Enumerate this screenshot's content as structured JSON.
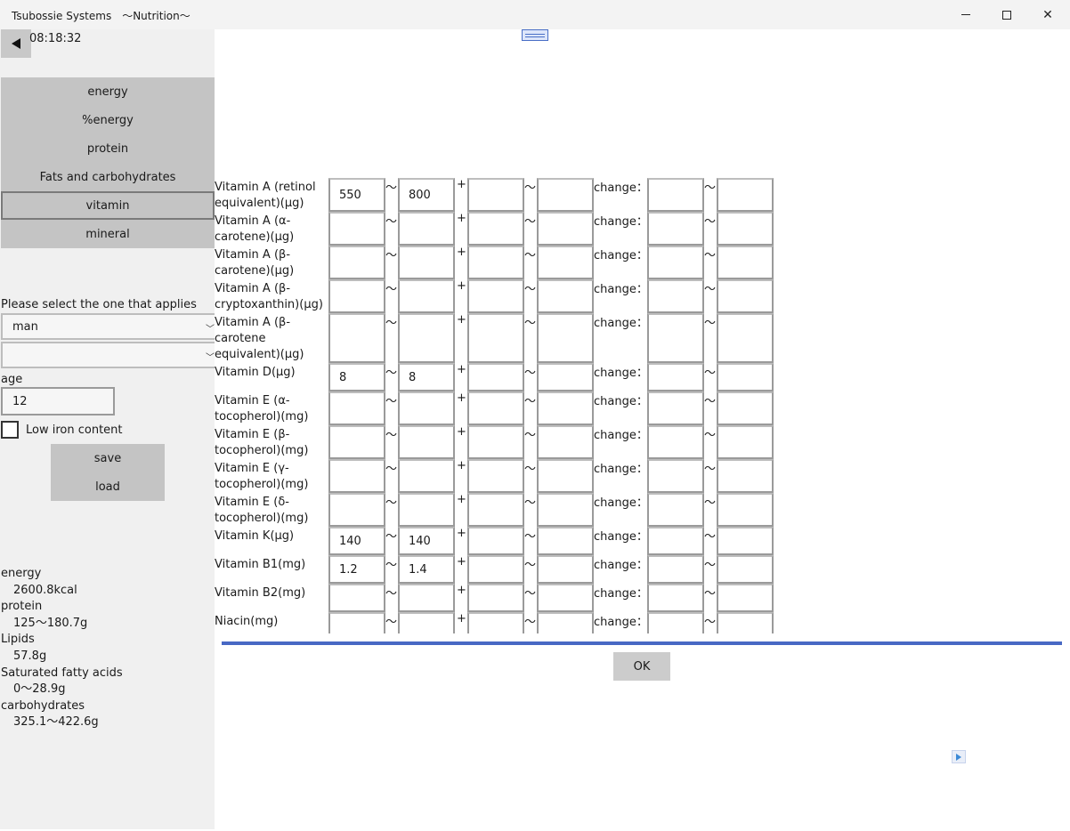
{
  "window": {
    "title": "Tsubossie Systems　〜Nutrition〜",
    "minimize_icon": "minimize-icon",
    "maximize_icon": "maximize-icon",
    "close_glyph": "✕"
  },
  "sidebar": {
    "clock": "08:18:32",
    "nav": [
      {
        "label": "energy"
      },
      {
        "label": "%energy"
      },
      {
        "label": "protein"
      },
      {
        "label": "Fats and carbohydrates"
      },
      {
        "label": "vitamin"
      },
      {
        "label": "mineral"
      }
    ],
    "active_nav": "vitamin",
    "prompt": "Please select the one that applies",
    "select1_value": "man",
    "select2_value": "",
    "age_label": "age",
    "age_value": "12",
    "low_iron_label": "Low iron content",
    "save_label": "save",
    "load_label": "load",
    "summary": [
      {
        "label": "energy",
        "value": "2600.8kcal"
      },
      {
        "label": "protein",
        "value": "125〜180.7g"
      },
      {
        "label": "Lipids",
        "value": "57.8g"
      },
      {
        "label": "Saturated fatty acids",
        "value": "0〜28.9g"
      },
      {
        "label": "carbohydrates",
        "value": "325.1〜422.6g"
      }
    ]
  },
  "main": {
    "tilde": "〜",
    "plus": "+",
    "change_label": "change：",
    "rows": [
      {
        "label": "Vitamin A (retinol equivalent)(μg)",
        "min": "550",
        "max": "800"
      },
      {
        "label": "Vitamin A (α-carotene)(μg)",
        "min": "",
        "max": ""
      },
      {
        "label": "Vitamin A (β-carotene)(μg)",
        "min": "",
        "max": ""
      },
      {
        "label": "Vitamin A (β-cryptoxanthin)(μg)",
        "min": "",
        "max": ""
      },
      {
        "label": "Vitamin A (β-carotene equivalent)(μg)",
        "min": "",
        "max": ""
      },
      {
        "label": "Vitamin D(μg)",
        "min": "8",
        "max": "8"
      },
      {
        "label": "Vitamin E (α-tocopherol)(mg)",
        "min": "",
        "max": ""
      },
      {
        "label": "Vitamin E (β-tocopherol)(mg)",
        "min": "",
        "max": ""
      },
      {
        "label": "Vitamin E (γ-tocopherol)(mg)",
        "min": "",
        "max": ""
      },
      {
        "label": "Vitamin E (δ-tocopherol)(mg)",
        "min": "",
        "max": ""
      },
      {
        "label": "Vitamin K(μg)",
        "min": "140",
        "max": "140"
      },
      {
        "label": "Vitamin B1(mg)",
        "min": "1.2",
        "max": "1.4"
      },
      {
        "label": "Vitamin B2(mg)",
        "min": "",
        "max": ""
      },
      {
        "label": "Niacin(mg)",
        "min": "",
        "max": ""
      }
    ],
    "ok_label": "OK",
    "ad_icon": "adchoices-icon"
  }
}
